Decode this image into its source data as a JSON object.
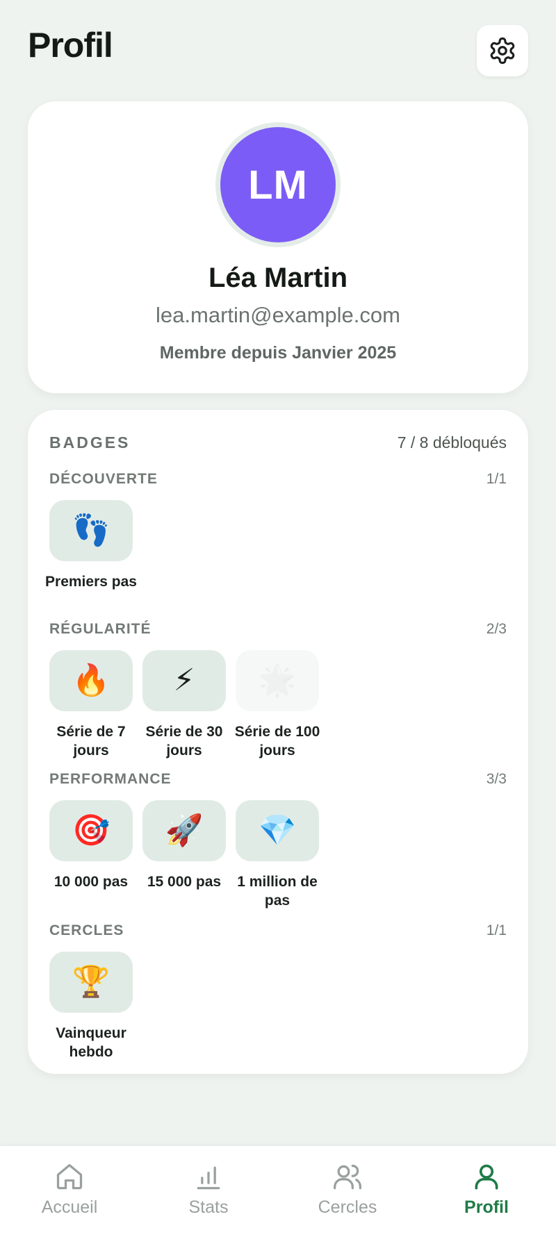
{
  "header": {
    "title": "Profil",
    "settings_icon": "gear-icon"
  },
  "profile": {
    "initials": "LM",
    "avatar_color": "#7c5cf6",
    "name": "Léa Martin",
    "email": "lea.martin@example.com",
    "member_since": "Membre depuis Janvier 2025"
  },
  "badges": {
    "title": "BADGES",
    "count": "7 / 8 débloqués",
    "sections": [
      {
        "title": "DÉCOUVERTE",
        "count": "1/1",
        "items": [
          {
            "emoji": "👣",
            "icon": "footprints-icon",
            "label": "Premiers pas",
            "unlocked": true
          }
        ]
      },
      {
        "title": "RÉGULARITÉ",
        "count": "2/3",
        "items": [
          {
            "emoji": "🔥",
            "icon": "fire-icon",
            "label": "Série de 7 jours",
            "unlocked": true
          },
          {
            "emoji": "⚡",
            "icon": "lightning-icon",
            "label": "Série de 30 jours",
            "unlocked": true
          },
          {
            "emoji": "🌟",
            "icon": "star-icon",
            "label": "Série de 100 jours",
            "unlocked": false
          }
        ]
      },
      {
        "title": "PERFORMANCE",
        "count": "3/3",
        "items": [
          {
            "emoji": "🎯",
            "icon": "target-icon",
            "label": "10 000 pas",
            "unlocked": true
          },
          {
            "emoji": "🚀",
            "icon": "rocket-icon",
            "label": "15 000 pas",
            "unlocked": true
          },
          {
            "emoji": "💎",
            "icon": "diamond-icon",
            "label": "1 million de pas",
            "unlocked": true
          }
        ]
      },
      {
        "title": "CERCLES",
        "count": "1/1",
        "items": [
          {
            "emoji": "🏆",
            "icon": "trophy-icon",
            "label": "Vainqueur hebdo",
            "unlocked": true
          }
        ]
      }
    ]
  },
  "nav": {
    "active_color": "#1f7a47",
    "items": [
      {
        "label": "Accueil",
        "icon": "home-icon",
        "active": false
      },
      {
        "label": "Stats",
        "icon": "bar-chart-icon",
        "active": false
      },
      {
        "label": "Cercles",
        "icon": "users-icon",
        "active": false
      },
      {
        "label": "Profil",
        "icon": "user-icon",
        "active": true
      }
    ]
  }
}
